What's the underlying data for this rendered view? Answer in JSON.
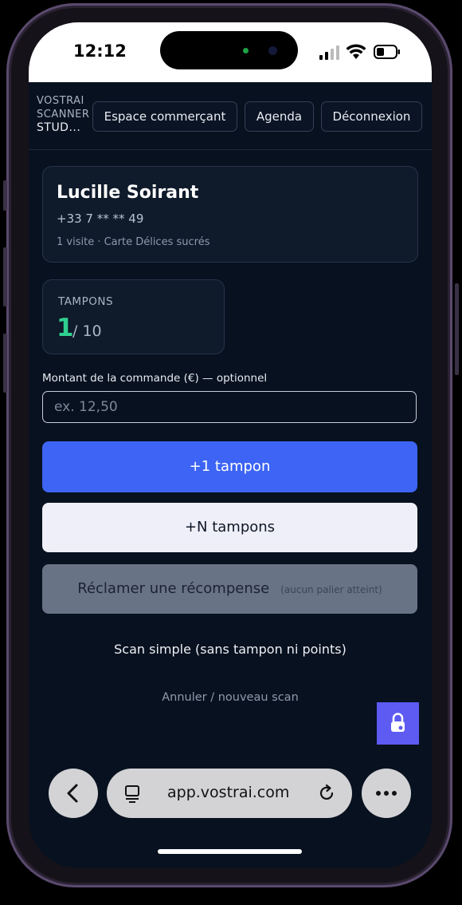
{
  "status_bar": {
    "time": "12:12",
    "icons": [
      "signal-icon",
      "wifi-icon",
      "battery-icon"
    ]
  },
  "header": {
    "brand_line1": "VOSTRAI",
    "brand_line2": "SCANNER",
    "brand_line3": "STUD...",
    "nav": {
      "merchant": "Espace commerçant",
      "agenda": "Agenda",
      "logout": "Déconnexion"
    }
  },
  "customer": {
    "name": "Lucille Soirant",
    "phone": "+33 7 ** ** 49",
    "meta": "1 visite · Carte Délices sucrés"
  },
  "stamps": {
    "label": "TAMPONS",
    "count": "1",
    "total": "/ 10"
  },
  "amount": {
    "label": "Montant de la commande (€) — optionnel",
    "placeholder": "ex. 12,50",
    "value": ""
  },
  "actions": {
    "add_one": "+1 tampon",
    "add_n": "+N tampons",
    "claim": "Réclamer une récompense",
    "claim_hint": "(aucun palier atteint)",
    "simple_scan": "Scan simple (sans tampon ni points)",
    "cancel": "Annuler / nouveau scan"
  },
  "browser": {
    "url": "app.vostrai.com",
    "icons": [
      "back-icon",
      "tabs-icon",
      "reload-icon",
      "more-icon"
    ]
  },
  "colors": {
    "accent": "#3d64f4",
    "stamp_green": "#2fd08f",
    "fab": "#5d5bf2",
    "background": "#08111f"
  }
}
